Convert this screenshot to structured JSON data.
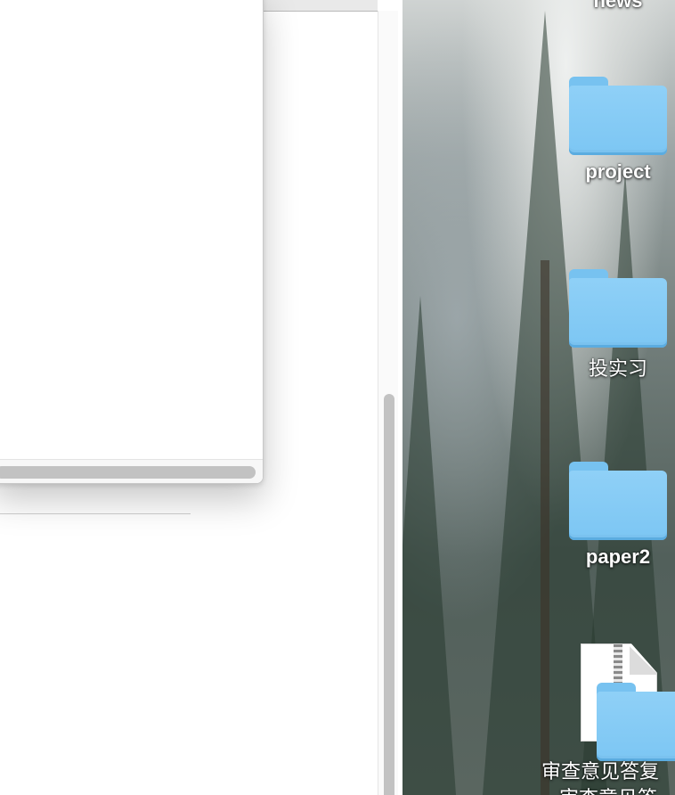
{
  "desktop": {
    "items": [
      {
        "label": "news",
        "type": "folder"
      },
      {
        "label": "project",
        "type": "folder"
      },
      {
        "label": "投实习",
        "type": "folder"
      },
      {
        "label": "paper2",
        "type": "folder"
      },
      {
        "label": "审查意见答复",
        "type": "zip-file"
      },
      {
        "label": "审查意见答",
        "type": "folder"
      }
    ]
  }
}
